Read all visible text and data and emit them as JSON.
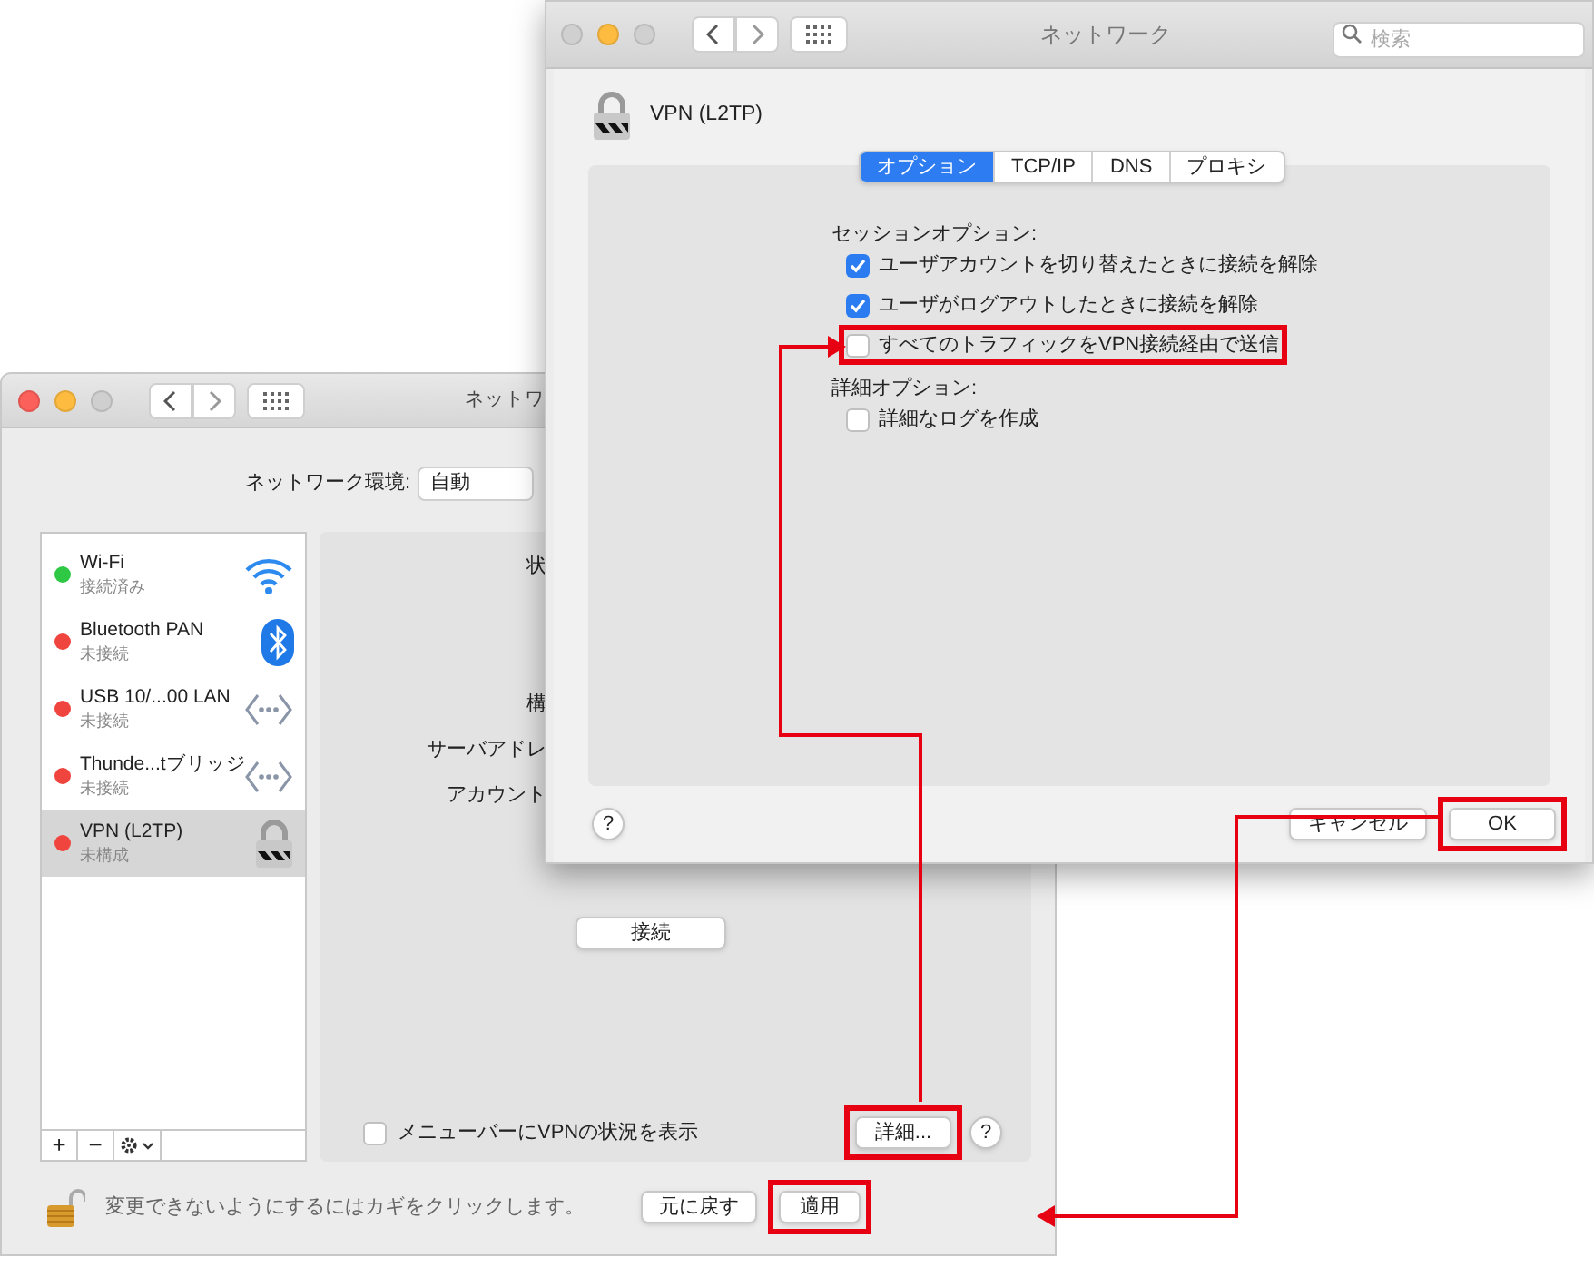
{
  "back_window": {
    "title": "ネットワ",
    "location": {
      "label": "ネットワーク環境:",
      "value": "自動"
    },
    "services": [
      {
        "name": "Wi-Fi",
        "status": "接続済み",
        "color": "#2ec845",
        "kind": "wifi",
        "selected": false
      },
      {
        "name": "Bluetooth PAN",
        "status": "未接続",
        "color": "#f0453f",
        "kind": "bluetooth",
        "selected": false
      },
      {
        "name": "USB 10/...00 LAN",
        "status": "未接続",
        "color": "#f0453f",
        "kind": "ethernet",
        "selected": false
      },
      {
        "name": "Thunde...tブリッジ",
        "status": "未接続",
        "color": "#f0453f",
        "kind": "ethernet",
        "selected": false
      },
      {
        "name": "VPN (L2TP)",
        "status": "未構成",
        "color": "#f0453f",
        "kind": "vpn",
        "selected": true
      }
    ],
    "list_toolbar": [
      "+",
      "−"
    ],
    "detail_labels": [
      "状",
      "構",
      "サーバアドレ",
      "アカウント"
    ],
    "connect_button": "接続",
    "menubar_checkbox": {
      "label": "メニューバーにVPNの状況を表示",
      "checked": false
    },
    "advanced_button": {
      "label": "詳細...",
      "highlighted": true
    },
    "help_label": "?",
    "lock_text": "変更できないようにするにはカギをクリックします。",
    "buttons": [
      {
        "label": "元に戻す",
        "highlighted": false
      },
      {
        "label": "適用",
        "highlighted": true
      }
    ]
  },
  "front_window": {
    "title": "ネットワーク",
    "search": {
      "placeholder": "検索"
    },
    "service": "VPN (L2TP)",
    "tabs": [
      {
        "label": "オプション",
        "selected": true
      },
      {
        "label": "TCP/IP",
        "selected": false
      },
      {
        "label": "DNS",
        "selected": false
      },
      {
        "label": "プロキシ",
        "selected": false
      }
    ],
    "sections": [
      {
        "heading": "セッションオプション:",
        "options": [
          {
            "label": "ユーザアカウントを切り替えたときに接続を解除",
            "checked": true,
            "highlighted": false
          },
          {
            "label": "ユーザがログアウトしたときに接続を解除",
            "checked": true,
            "highlighted": false
          },
          {
            "label": "すべてのトラフィックをVPN接続経由で送信",
            "checked": false,
            "highlighted": true
          }
        ]
      },
      {
        "heading": "詳細オプション:",
        "options": [
          {
            "label": "詳細なログを作成",
            "checked": false,
            "highlighted": false
          }
        ]
      }
    ],
    "help_label": "?",
    "buttons": [
      {
        "label": "キャンセル",
        "highlighted": false
      },
      {
        "label": "OK",
        "highlighted": true
      }
    ]
  }
}
